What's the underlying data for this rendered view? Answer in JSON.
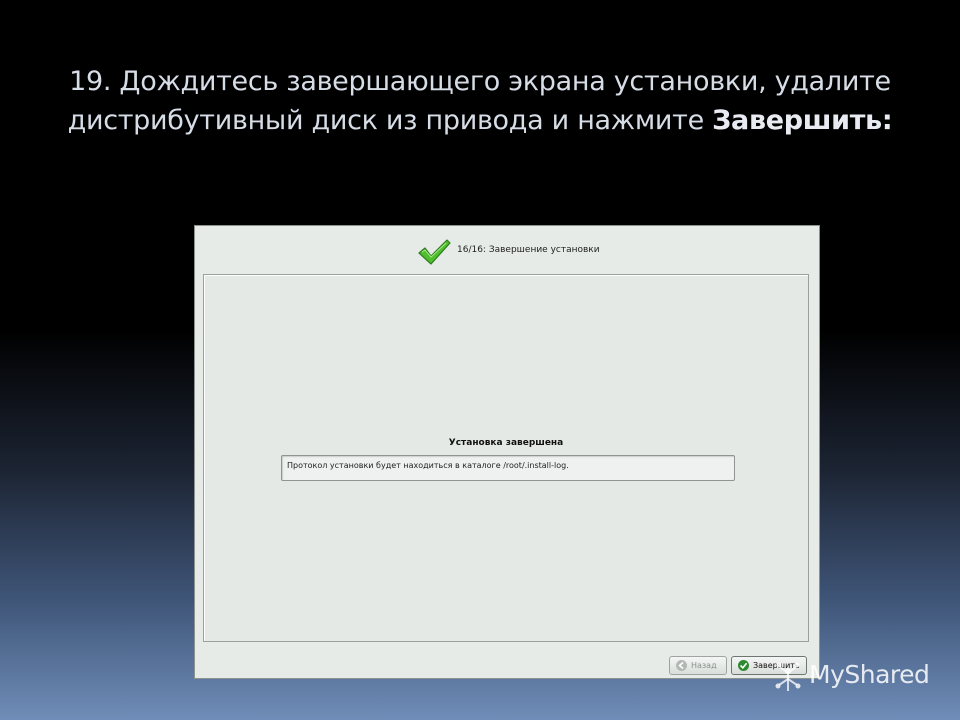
{
  "slide": {
    "title_line1": "19. Дождитесь завершающего экрана установки, удалите",
    "title_line2_prefix": "дистрибутивный диск из привода и нажмите ",
    "title_line2_bold": "Завершить:"
  },
  "installer": {
    "step_label": "16/16: Завершение установки",
    "done_title": "Установка завершена",
    "log_message": "Протокол установки будет находиться в каталоге /root/.install-log.",
    "back_button": "Назад",
    "finish_button": "Завершить",
    "check_color": "#4fbf2e"
  },
  "watermark": {
    "text": "MyShared"
  }
}
